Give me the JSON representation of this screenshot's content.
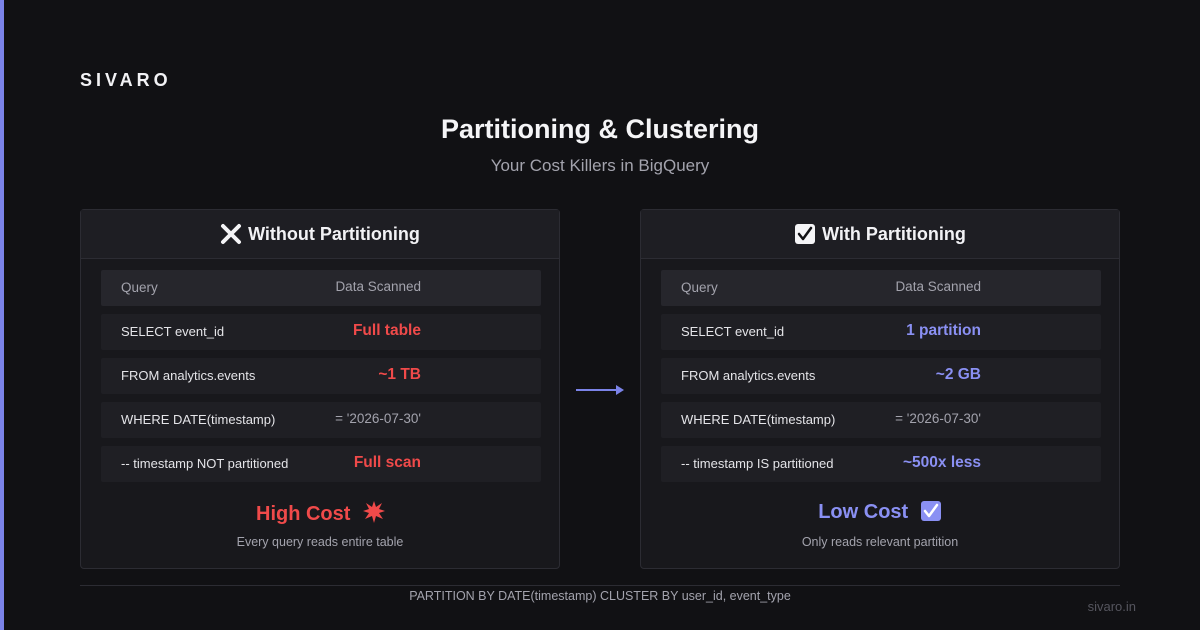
{
  "brand": "SIVARO",
  "title": "Partitioning & Clustering",
  "subtitle": "Your Cost Killers in BigQuery",
  "colors": {
    "accent": "#7b83e8",
    "bad": "#f04a4a",
    "good": "#8a90f3",
    "background": "#111114"
  },
  "left_panel": {
    "title": "Without Partitioning",
    "icon": "x-icon",
    "header": {
      "query": "Query",
      "scanned": "Data Scanned"
    },
    "rows": [
      {
        "query": "SELECT event_id",
        "scanned": "Full table"
      },
      {
        "query": "FROM analytics.events",
        "scanned": "~1 TB"
      },
      {
        "query": "WHERE DATE(timestamp)",
        "scanned": "= '2026-07-30'"
      },
      {
        "query": "-- timestamp NOT partitioned",
        "scanned": "Full scan"
      }
    ],
    "verdict": "High Cost",
    "verdict_icon": "explosion-icon",
    "verdict_sub": "Every query reads entire table"
  },
  "right_panel": {
    "title": "With Partitioning",
    "icon": "check-icon",
    "header": {
      "query": "Query",
      "scanned": "Data Scanned"
    },
    "rows": [
      {
        "query": "SELECT event_id",
        "scanned": "1 partition"
      },
      {
        "query": "FROM analytics.events",
        "scanned": "~2 GB"
      },
      {
        "query": "WHERE DATE(timestamp)",
        "scanned": "= '2026-07-30'"
      },
      {
        "query": "-- timestamp IS partitioned",
        "scanned": "~500x less"
      }
    ],
    "verdict": "Low Cost",
    "verdict_icon": "check-icon",
    "verdict_sub": "Only reads relevant partition"
  },
  "footer_code": "PARTITION BY DATE(timestamp) CLUSTER BY user_id, event_type",
  "site": "sivaro.in"
}
